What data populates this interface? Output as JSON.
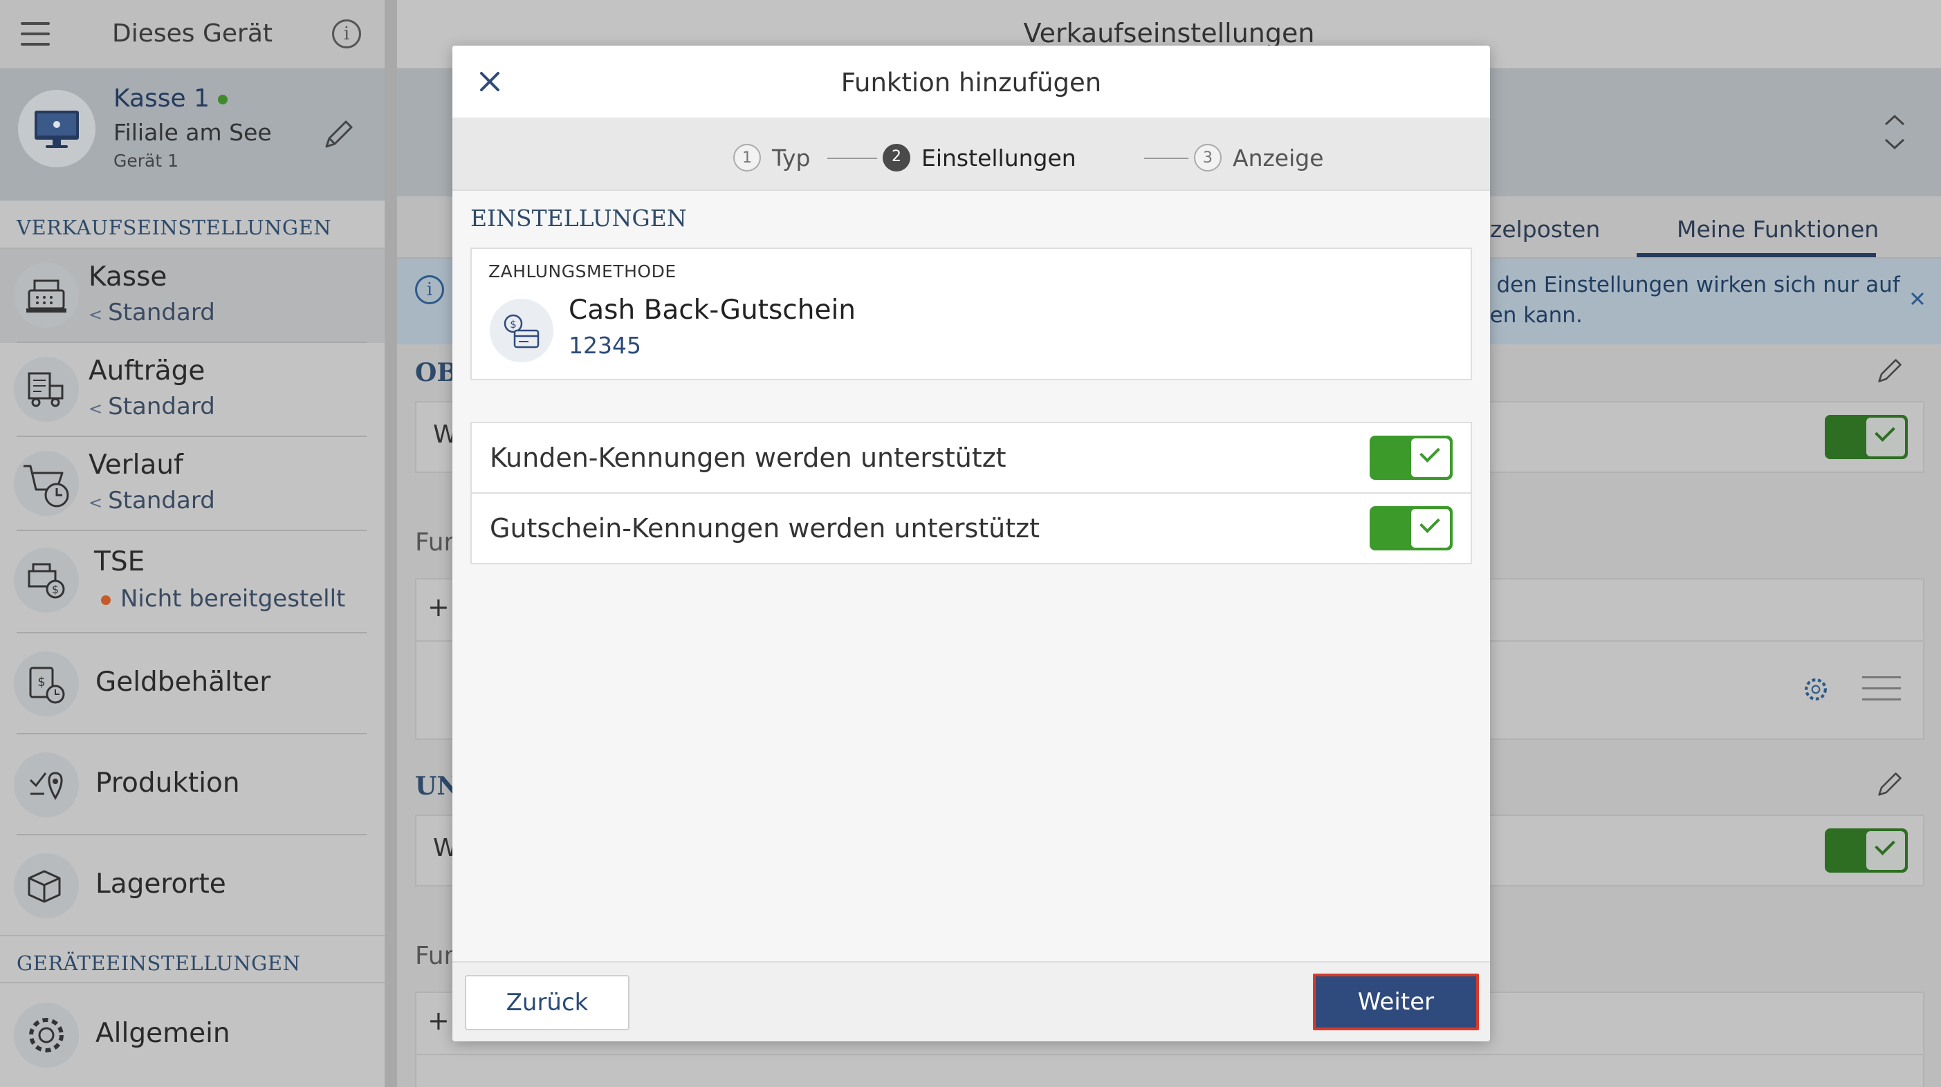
{
  "sidebar": {
    "title": "Dieses Gerät",
    "info_glyph": "i",
    "device": {
      "name": "Kasse 1",
      "branch": "Filiale am See",
      "sub": "Gerät 1",
      "status_color": "#3f8a2a"
    },
    "section_sales": "VERKAUFSEINSTELLUNGEN",
    "items": [
      {
        "title": "Kasse",
        "sub": "Standard",
        "icon": "cash-register-icon"
      },
      {
        "title": "Aufträge",
        "sub": "Standard",
        "icon": "order-truck-icon"
      },
      {
        "title": "Verlauf",
        "sub": "Standard",
        "icon": "history-cart-icon"
      },
      {
        "title": "TSE",
        "sub": "Nicht bereitgestellt",
        "icon": "tse-icon"
      },
      {
        "title": "Geldbehälter",
        "icon": "cash-drawer-icon"
      },
      {
        "title": "Produktion",
        "icon": "production-icon"
      },
      {
        "title": "Lagerorte",
        "icon": "storage-icon"
      }
    ],
    "section_device": "GERÄTEEINSTELLUNGEN",
    "general": {
      "title": "Allgemein",
      "icon": "gear-icon"
    }
  },
  "main": {
    "title": "Verkaufseinstellungen",
    "tabs": [
      "zelposten",
      "Meine Funktionen"
    ],
    "notice_line1": "n den Einstellungen wirken sich nur auf",
    "notice_line2": "den kann.",
    "cut_labels": {
      "obi": "OBI",
      "w1": "W",
      "fun1": "Fun",
      "plus1": "+",
      "uni": "UNI",
      "w2": "W",
      "fun2": "Fun",
      "plus2": "+"
    }
  },
  "modal": {
    "title": "Funktion hinzufügen",
    "steps": [
      {
        "num": "1",
        "label": "Typ",
        "state": "inactive"
      },
      {
        "num": "2",
        "label": "Einstellungen",
        "state": "active"
      },
      {
        "num": "3",
        "label": "Anzeige",
        "state": "inactive"
      }
    ],
    "heading": "EINSTELLUNGEN",
    "payment": {
      "label": "ZAHLUNGSMETHODE",
      "name": "Cash Back-Gutschein",
      "code": "12345"
    },
    "options": [
      {
        "label": "Kunden-Kennungen werden unterstützt",
        "enabled": true
      },
      {
        "label": "Gutschein-Kennungen werden unterstützt",
        "enabled": true
      }
    ],
    "footer": {
      "back_label": "Zurück",
      "next_label": "Weiter"
    }
  },
  "colors": {
    "accent": "#2f4a7c",
    "toggle_on": "#3c9a2a",
    "highlight_border": "#d63a2a"
  }
}
